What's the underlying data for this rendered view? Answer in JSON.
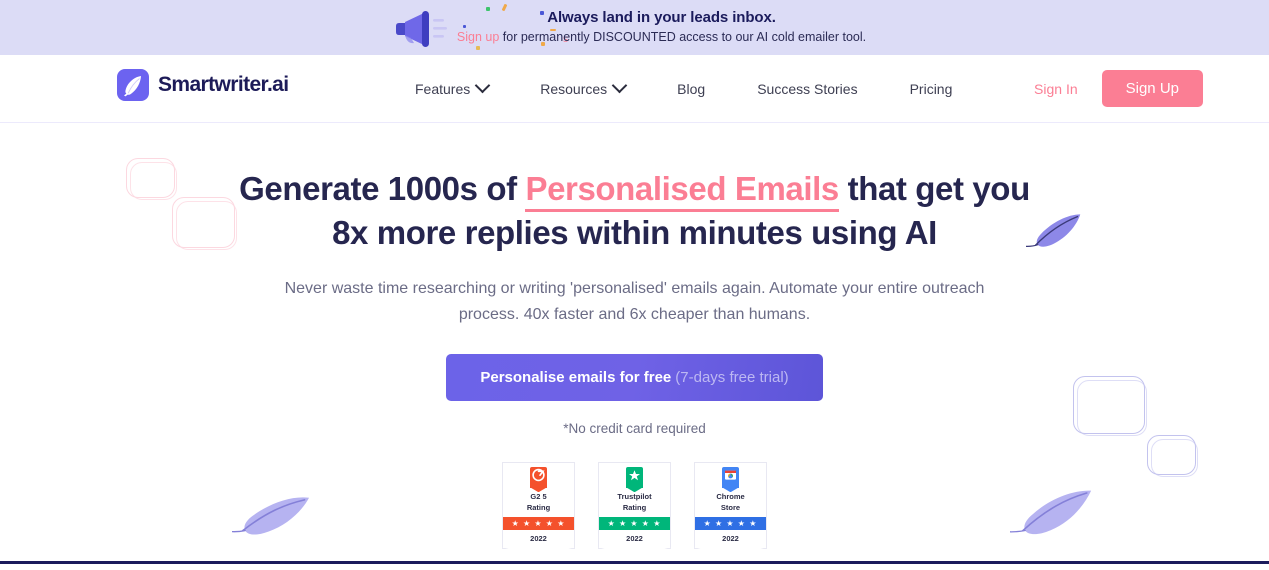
{
  "banner": {
    "icon": "megaphone-icon",
    "title": "Always land in your leads inbox.",
    "link_text": "Sign up",
    "sub_rest": " for permanently DISCOUNTED access to our AI cold emailer tool.",
    "bg_color": "#dcdcf6",
    "link_color": "#fb7e94"
  },
  "navbar": {
    "logo": {
      "icon": "feather-icon",
      "text": "Smartwriter.ai",
      "mark_color": "#6c63f0",
      "text_color": "#1d1b58"
    },
    "links": [
      {
        "label": "Features",
        "has_dropdown": true,
        "icon": "chevron-down-icon"
      },
      {
        "label": "Resources",
        "has_dropdown": true,
        "icon": "chevron-down-icon"
      },
      {
        "label": "Blog",
        "has_dropdown": false
      },
      {
        "label": "Success Stories",
        "has_dropdown": false
      },
      {
        "label": "Pricing",
        "has_dropdown": false
      }
    ],
    "sign_in": "Sign In",
    "sign_up": "Sign Up",
    "accent_color": "#fb7e94"
  },
  "hero": {
    "headline_part1": "Generate 1000s of ",
    "headline_highlight": "Personalised Emails",
    "headline_part2": " that get you 8x more replies within minutes using AI",
    "highlight_color": "#fb7e94",
    "subheading": "Never waste time researching or writing 'personalised' emails again. Automate your entire outreach process. 40x faster and 6x cheaper than humans.",
    "cta_label": "Personalise emails for free",
    "cta_sublabel": "(7-days free trial)",
    "cta_color": "#6c63e8",
    "no_card_note": "*No credit card required"
  },
  "badges": [
    {
      "logo_name": "g2-logo-icon",
      "logo_glyph": "G",
      "logo_color": "#f4512c",
      "title": "G2 5 Rating",
      "title_line1": "G2 5",
      "title_line2": "Rating",
      "stars": "★ ★ ★ ★ ★",
      "bar_color": "#f4512c",
      "year": "2022"
    },
    {
      "logo_name": "trustpilot-logo-icon",
      "logo_glyph": "★",
      "logo_color": "#00b67a",
      "title": "Trustpilot Rating",
      "title_line1": "Trustpilot",
      "title_line2": "Rating",
      "stars": "★ ★ ★ ★ ★",
      "bar_color": "#00b67a",
      "year": "2022"
    },
    {
      "logo_name": "chrome-store-logo-icon",
      "logo_glyph": "▣",
      "logo_color": "#4285f4",
      "title": "Chrome Store",
      "title_line1": "Chrome",
      "title_line2": "Store",
      "stars": "★ ★ ★ ★ ★",
      "bar_color": "#2f6fe4",
      "year": "2022"
    }
  ],
  "decorations": {
    "feather_color": "#8d88e8",
    "pink_square_color": "#fcd8e0",
    "blue_square_color": "#c3c3ee",
    "bottom_rule_color": "#1b1b5c"
  }
}
